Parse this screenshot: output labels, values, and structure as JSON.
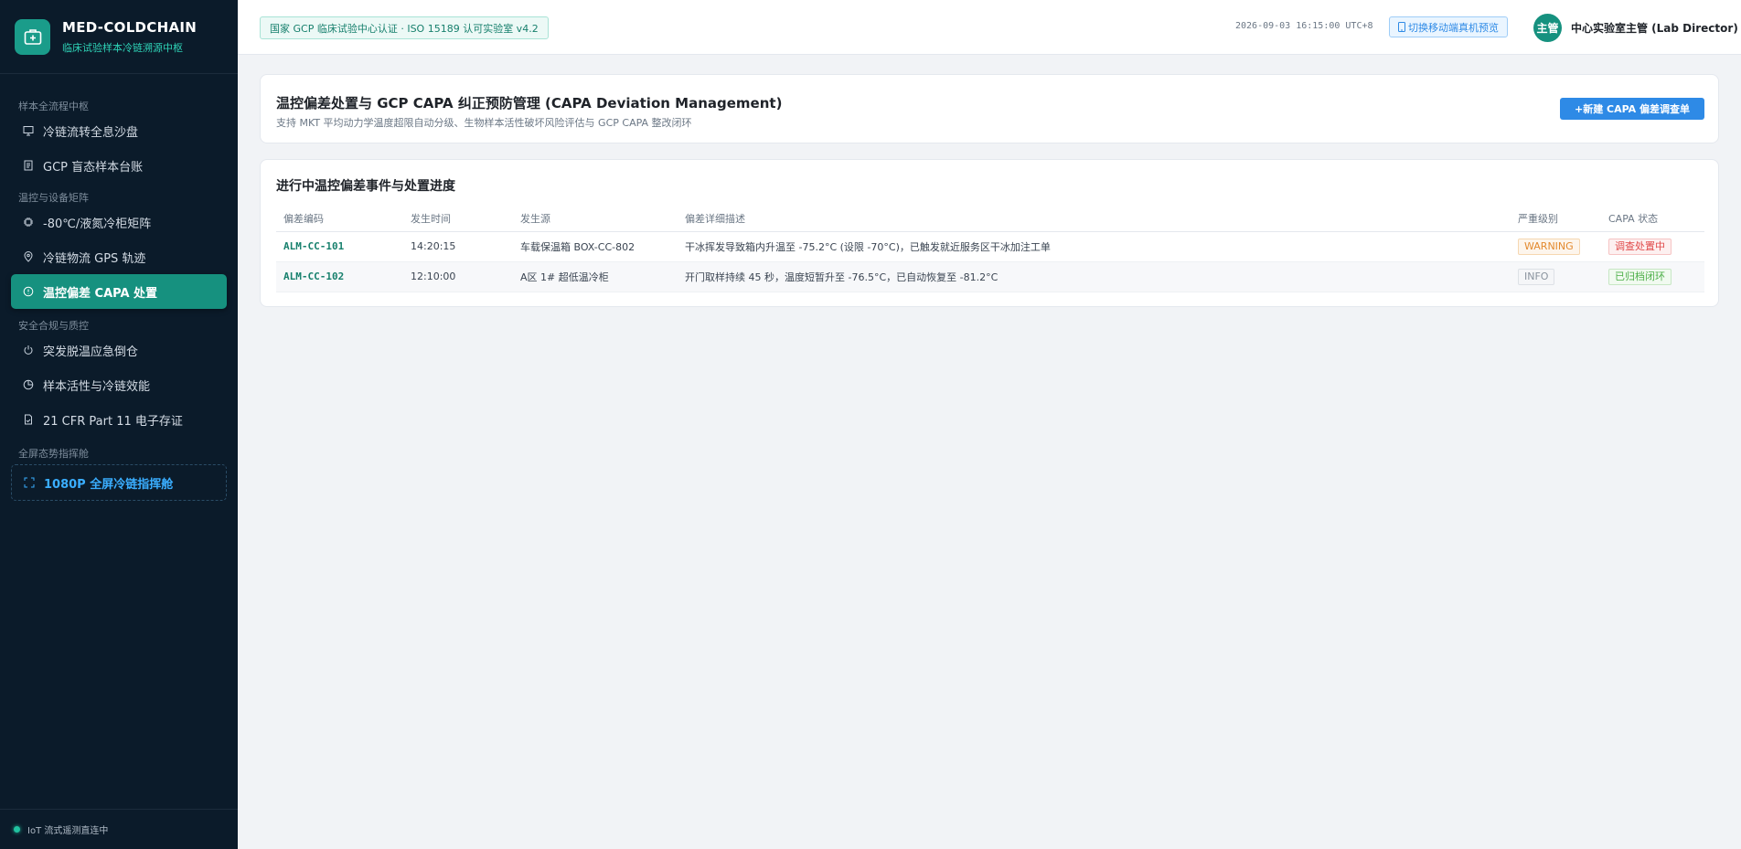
{
  "brand": {
    "name": "MED-COLDCHAIN",
    "subtitle": "临床试验样本冷链溯源中枢"
  },
  "sidebar": {
    "sections": [
      {
        "title": "样本全流程中枢",
        "items": [
          {
            "label": "冷链流转全息沙盘",
            "icon": "monitor-icon"
          },
          {
            "label": "GCP 盲态样本台账",
            "icon": "document-icon"
          }
        ]
      },
      {
        "title": "温控与设备矩阵",
        "items": [
          {
            "label": "-80℃/液氮冷柜矩阵",
            "icon": "chip-icon"
          },
          {
            "label": "冷链物流 GPS 轨迹",
            "icon": "location-pin-icon"
          },
          {
            "label": "温控偏差 CAPA 处置",
            "icon": "alert-circle-icon"
          }
        ]
      },
      {
        "title": "安全合规与质控",
        "items": [
          {
            "label": "突发脱温应急倒仓",
            "icon": "power-icon"
          },
          {
            "label": "样本活性与冷链效能",
            "icon": "pie-chart-icon"
          },
          {
            "label": "21 CFR Part 11 电子存证",
            "icon": "file-check-icon"
          }
        ]
      },
      {
        "title": "全屏态势指挥舱",
        "items": [
          {
            "label": "1080P 全屏冷链指挥舱",
            "icon": "fullscreen-icon"
          }
        ]
      }
    ],
    "footer_status": "IoT 流式遥测直连中"
  },
  "header": {
    "cert_badge": "国家 GCP 临床试验中心认证 · ISO 15189 认可实验室 v4.2",
    "timestamp": "2026-09-03 16:15:00 UTC+8",
    "switch_button": "切换移动端真机预览",
    "avatar_text": "主管",
    "user_name": "中心实验室主管 (Lab Director)"
  },
  "page": {
    "title": "温控偏差处置与 GCP CAPA 纠正预防管理 (CAPA Deviation Management)",
    "description": "支持 MKT 平均动力学温度超限自动分级、生物样本活性破坏风险评估与 GCP CAPA 整改闭环",
    "new_button": "+新建 CAPA 偏差调查单"
  },
  "events": {
    "title": "进行中温控偏差事件与处置进度",
    "columns": [
      "偏差编码",
      "发生时间",
      "发生源",
      "偏差详细描述",
      "严重级别",
      "CAPA 状态"
    ],
    "rows": [
      {
        "code": "ALM-CC-101",
        "time": "14:20:15",
        "source": "车载保温箱 BOX-CC-802",
        "description": "干冰挥发导致箱内升温至 -75.2°C (设限 -70°C)，已触发就近服务区干冰加注工单",
        "severity": "WARNING",
        "status": "调查处置中"
      },
      {
        "code": "ALM-CC-102",
        "time": "12:10:00",
        "source": "A区 1# 超低温冷柜",
        "description": "开门取样持续 45 秒，温度短暂升至 -76.5°C，已自动恢复至 -81.2°C",
        "severity": "INFO",
        "status": "已归档闭环"
      }
    ]
  },
  "colors": {
    "sidebar_bg": "#0b1b2a",
    "accent_teal": "#16917f",
    "accent_blue": "#2e8ae6",
    "warning": "#e38a2f",
    "danger": "#e04a4a",
    "success": "#4aae46"
  }
}
